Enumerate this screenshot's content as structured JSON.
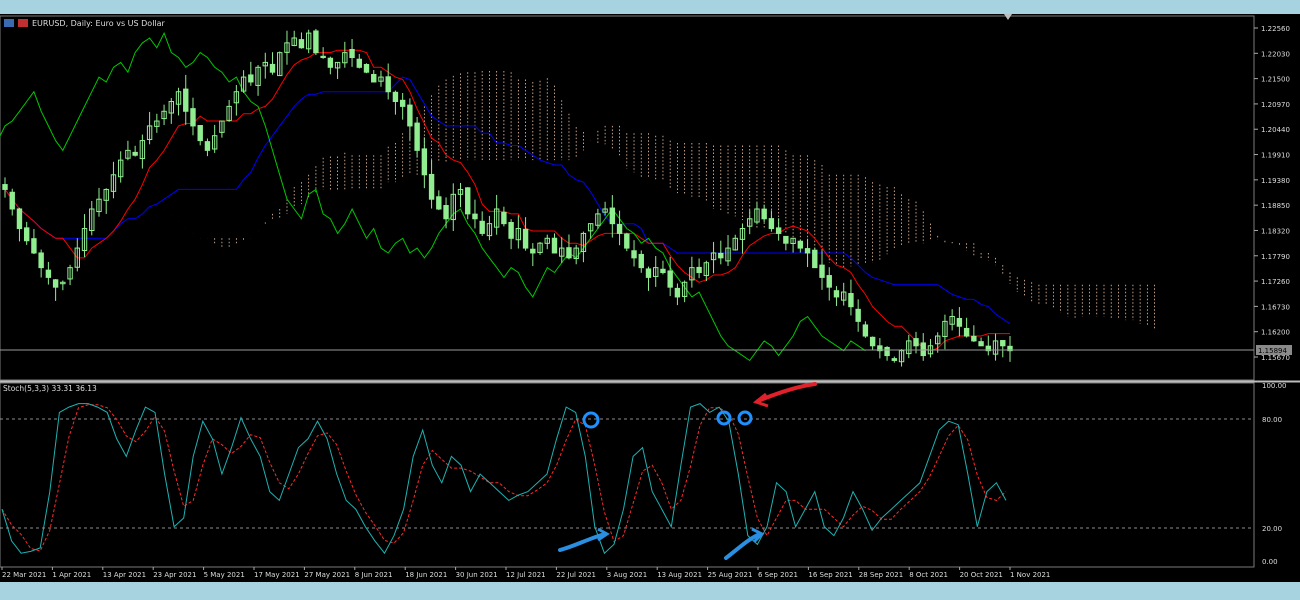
{
  "window": {
    "title": "EURUSD, Daily: Euro vs US Dollar"
  },
  "price_chart": {
    "current_price_label": "1.15894",
    "price_axis": [
      "1.22560",
      "1.22030",
      "1.21500",
      "1.20970",
      "1.20440",
      "1.19910",
      "1.19380",
      "1.18850",
      "1.18320",
      "1.17790",
      "1.17260",
      "1.16730",
      "1.16200",
      "1.15670"
    ],
    "colors": {
      "bull_candle": "#90ee90",
      "tenkan": "#ff0000",
      "kijun": "#0000ff",
      "chikou": "#00c800",
      "cloud": "#f4c7a6",
      "background": "#000000"
    }
  },
  "stoch_panel": {
    "label": "Stoch(5,3,3) 33.31 36.13",
    "levels": [
      "100.00",
      "80.00",
      "20.00",
      "0.00"
    ],
    "colors": {
      "main": "#1fb2b2",
      "signal": "#ff2a2a",
      "annotation_circle": "#1e90ff",
      "arrow_blue": "#2a8fe0",
      "arrow_red": "#e0202a"
    }
  },
  "time_axis": [
    "22 Mar 2021",
    "1 Apr 2021",
    "13 Apr 2021",
    "23 Apr 2021",
    "5 May 2021",
    "17 May 2021",
    "27 May 2021",
    "8 Jun 2021",
    "18 Jun 2021",
    "30 Jun 2021",
    "12 Jul 2021",
    "22 Jul 2021",
    "3 Aug 2021",
    "13 Aug 2021",
    "25 Aug 2021",
    "6 Sep 2021",
    "16 Sep 2021",
    "28 Sep 2021",
    "8 Oct 2021",
    "20 Oct 2021",
    "1 Nov 2021"
  ],
  "chart_data": {
    "type": "line",
    "title": "EURUSD, Daily: Euro vs US Dollar",
    "symbol": "EURUSD",
    "timeframe": "Daily",
    "price_range": [
      1.153,
      1.2275
    ],
    "current_price": 1.15894,
    "stochastic": {
      "params": "5,3,3",
      "main": 33.31,
      "signal": 36.13,
      "levels": [
        80,
        20
      ],
      "range": [
        0,
        100
      ]
    },
    "x_tick_labels": [
      "22 Mar 2021",
      "1 Apr 2021",
      "13 Apr 2021",
      "23 Apr 2021",
      "5 May 2021",
      "17 May 2021",
      "27 May 2021",
      "8 Jun 2021",
      "18 Jun 2021",
      "30 Jun 2021",
      "12 Jul 2021",
      "22 Jul 2021",
      "3 Aug 2021",
      "13 Aug 2021",
      "25 Aug 2021",
      "6 Sep 2021",
      "16 Sep 2021",
      "28 Sep 2021",
      "8 Oct 2021",
      "20 Oct 2021",
      "1 Nov 2021"
    ],
    "closes": [
      1.192,
      1.188,
      1.184,
      1.1815,
      1.179,
      1.176,
      1.174,
      1.172,
      1.173,
      1.176,
      1.18,
      1.184,
      1.188,
      1.19,
      1.192,
      1.195,
      1.198,
      1.2,
      1.199,
      1.202,
      1.205,
      1.206,
      1.208,
      1.21,
      1.212,
      1.208,
      1.205,
      1.202,
      1.2,
      1.203,
      1.206,
      1.209,
      1.212,
      1.215,
      1.214,
      1.217,
      1.218,
      1.216,
      1.22,
      1.222,
      1.223,
      1.221,
      1.224,
      1.22,
      1.219,
      1.217,
      1.218,
      1.22,
      1.219,
      1.217,
      1.216,
      1.214,
      1.215,
      1.212,
      1.21,
      1.209,
      1.205,
      1.2,
      1.195,
      1.19,
      1.188,
      1.186,
      1.191,
      1.192,
      1.187,
      1.186,
      1.183,
      1.185,
      1.188,
      1.185,
      1.182,
      1.184,
      1.18,
      1.179,
      1.181,
      1.182,
      1.179,
      1.18,
      1.178,
      1.18,
      1.183,
      1.185,
      1.187,
      1.188,
      1.185,
      1.183,
      1.18,
      1.178,
      1.176,
      1.174,
      1.176,
      1.175,
      1.172,
      1.17,
      1.173,
      1.176,
      1.175,
      1.177,
      1.179,
      1.178,
      1.18,
      1.182,
      1.184,
      1.186,
      1.188,
      1.186,
      1.184,
      1.183,
      1.181,
      1.182,
      1.18,
      1.179,
      1.176,
      1.174,
      1.172,
      1.17,
      1.171,
      1.168,
      1.165,
      1.162,
      1.16,
      1.159,
      1.158,
      1.157,
      1.159,
      1.161,
      1.16,
      1.158,
      1.16,
      1.162,
      1.165,
      1.166,
      1.164,
      1.162,
      1.161,
      1.16,
      1.159,
      1.161,
      1.16,
      1.159
    ],
    "stoch_main": [
      30,
      12,
      5,
      6,
      8,
      40,
      85,
      88,
      90,
      90,
      88,
      85,
      70,
      60,
      75,
      88,
      85,
      50,
      20,
      25,
      60,
      80,
      70,
      50,
      65,
      82,
      70,
      60,
      40,
      35,
      50,
      65,
      70,
      80,
      70,
      50,
      35,
      30,
      20,
      12,
      5,
      15,
      30,
      60,
      75,
      55,
      45,
      60,
      55,
      40,
      50,
      45,
      40,
      35,
      38,
      40,
      45,
      50,
      70,
      88,
      85,
      60,
      20,
      5,
      10,
      30,
      60,
      65,
      40,
      30,
      20,
      55,
      88,
      90,
      85,
      88,
      80,
      50,
      15,
      10,
      20,
      45,
      40,
      20,
      30,
      40,
      20,
      15,
      25,
      40,
      30,
      18,
      25,
      30,
      35,
      40,
      45,
      60,
      75,
      80,
      78,
      50,
      20,
      40,
      45,
      35
    ]
  },
  "annotations": [
    {
      "kind": "circle",
      "name": "stoch-cross-1"
    },
    {
      "kind": "circle",
      "name": "stoch-cross-2"
    },
    {
      "kind": "circle",
      "name": "stoch-cross-3"
    },
    {
      "kind": "arrow",
      "name": "blue-arrow-1"
    },
    {
      "kind": "arrow",
      "name": "blue-arrow-2"
    },
    {
      "kind": "arrow",
      "name": "red-arrow"
    }
  ]
}
